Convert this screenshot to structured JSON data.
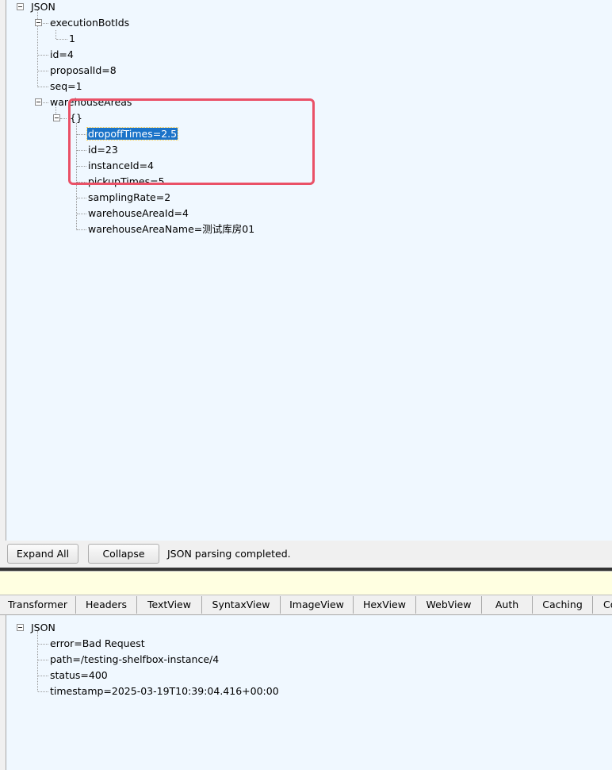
{
  "request_tree": {
    "root": "JSON",
    "nodes": [
      "executionBotIds",
      "1",
      "id=4",
      "proposalId=8",
      "seq=1",
      "warehouseAreas",
      "{}",
      "dropoffTimes=2.5",
      "id=23",
      "instanceId=4",
      "pickupTimes=5",
      "samplingRate=2",
      "warehouseAreaId=4",
      "warehouseAreaName=测试库房01"
    ]
  },
  "toolbar": {
    "expand_all_label": "Expand All",
    "collapse_label": "Collapse",
    "status": "JSON parsing completed."
  },
  "response_tabs": [
    "Transformer",
    "Headers",
    "TextView",
    "SyntaxView",
    "ImageView",
    "HexView",
    "WebView",
    "Auth",
    "Caching",
    "Co"
  ],
  "response_tree": {
    "root": "JSON",
    "nodes": [
      "error=Bad Request",
      "path=/testing-shelfbox-instance/4",
      "status=400",
      "timestamp=2025-03-19T10:39:04.416+00:00"
    ]
  },
  "colors": {
    "pane_background": "#f0f8ff",
    "selection": "#1a73c9",
    "callout_border": "#ea5167",
    "info_bar": "#ffffe1"
  }
}
